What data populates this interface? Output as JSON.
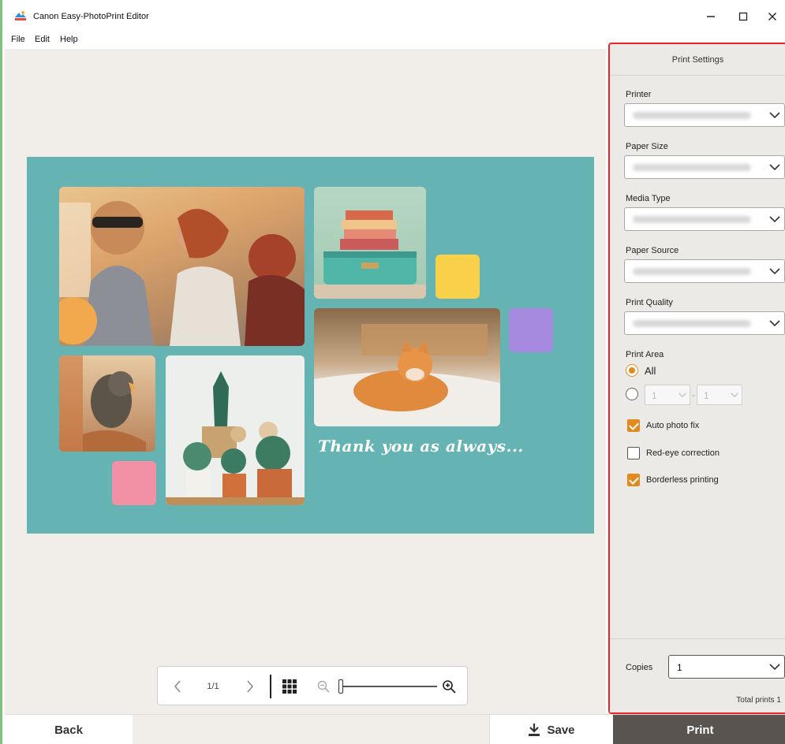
{
  "window": {
    "title": "Canon Easy-PhotoPrint Editor",
    "controls": [
      "minimize",
      "maximize",
      "close"
    ]
  },
  "menu": {
    "items": [
      "File",
      "Edit",
      "Help"
    ]
  },
  "card": {
    "message": "Thank you as always...",
    "colors": {
      "background": "#65b3b3",
      "yellow_tile": "#f9d04a",
      "purple_tile": "#a58ae0",
      "pink_tile": "#f291a5"
    },
    "photos": [
      "friends-photo",
      "suitcase-books-photo",
      "cat-photo",
      "parrot-photo",
      "cactus-plants-photo"
    ]
  },
  "navigation": {
    "page_indicator": "1/1"
  },
  "print_settings": {
    "header": "Print Settings",
    "printer_label": "Printer",
    "paper_size_label": "Paper Size",
    "media_type_label": "Media Type",
    "paper_source_label": "Paper Source",
    "print_quality_label": "Print Quality",
    "print_area_label": "Print Area",
    "print_area_all": "All",
    "range_from": "1",
    "range_to": "1",
    "auto_photo_fix": "Auto photo fix",
    "red_eye": "Red-eye correction",
    "borderless": "Borderless printing",
    "auto_photo_fix_checked": true,
    "red_eye_checked": false,
    "borderless_checked": true,
    "copies_label": "Copies",
    "copies_value": "1",
    "total_prints": "Total prints  1",
    "accent_color": "#e38a1e",
    "highlight_color": "#e8242a"
  },
  "actions": {
    "back": "Back",
    "save": "Save",
    "print": "Print"
  }
}
